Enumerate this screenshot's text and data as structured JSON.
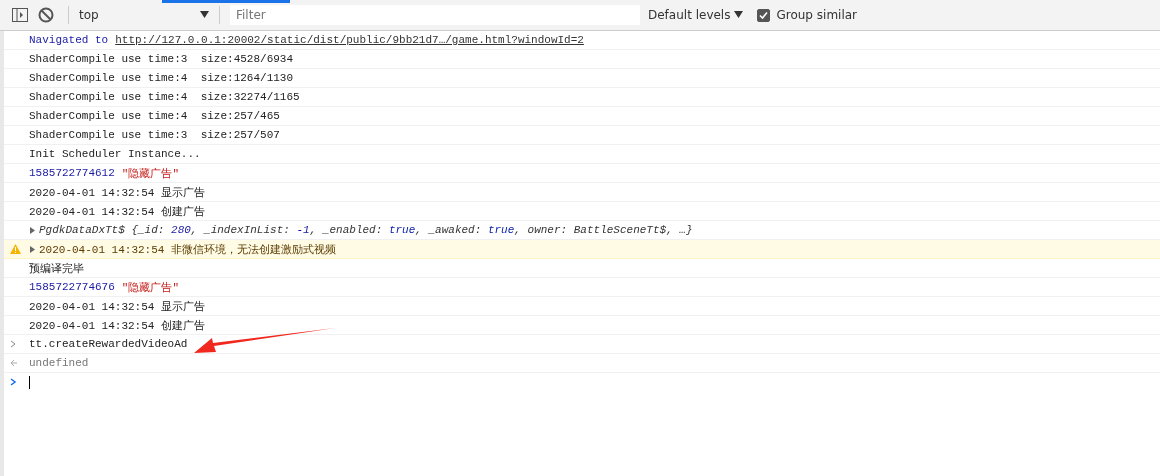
{
  "toolbar": {
    "context": "top",
    "filter": {
      "placeholder": "Filter"
    },
    "levels": "Default levels",
    "group_similar": {
      "label": "Group similar",
      "checked": true
    }
  },
  "console": [
    {
      "kind": "nav",
      "prefix": "Navigated to",
      "link": "http://127.0.0.1:20002/static/dist/public/9bb21d7…/game.html?windowId=2"
    },
    {
      "kind": "log",
      "text": "ShaderCompile use time:3  size:4528/6934"
    },
    {
      "kind": "log",
      "text": "ShaderCompile use time:4  size:1264/1130"
    },
    {
      "kind": "log",
      "text": "ShaderCompile use time:4  size:32274/1165"
    },
    {
      "kind": "log",
      "text": "ShaderCompile use time:4  size:257/465"
    },
    {
      "kind": "log",
      "text": "ShaderCompile use time:3  size:257/507"
    },
    {
      "kind": "log",
      "text": "Init Scheduler Instance..."
    },
    {
      "kind": "numstr",
      "number": "1585722774612",
      "string": "\"隐藏广告\""
    },
    {
      "kind": "log",
      "text": "2020-04-01 14:32:54 显示广告"
    },
    {
      "kind": "log",
      "text": "2020-04-01 14:32:54 创建广告"
    },
    {
      "kind": "object",
      "expanded": false,
      "parts": [
        {
          "text": "PgdkDataDxTt$ {_id: ",
          "kind": "plain"
        },
        {
          "text": "280",
          "kind": "number"
        },
        {
          "text": ", _indexInList: ",
          "kind": "plain"
        },
        {
          "text": "-1",
          "kind": "number"
        },
        {
          "text": ", _enabled: ",
          "kind": "plain"
        },
        {
          "text": "true",
          "kind": "bool"
        },
        {
          "text": ", _awaked: ",
          "kind": "plain"
        },
        {
          "text": "true",
          "kind": "bool"
        },
        {
          "text": ", owner: BattleSceneTt$, …}",
          "kind": "plain"
        }
      ]
    },
    {
      "kind": "warning",
      "expanded": false,
      "text": "2020-04-01 14:32:54 非微信环境，无法创建激励式视频"
    },
    {
      "kind": "log",
      "text": "预编译完毕"
    },
    {
      "kind": "numstr",
      "number": "1585722774676",
      "string": "\"隐藏广告\""
    },
    {
      "kind": "log",
      "text": "2020-04-01 14:32:54 显示广告"
    },
    {
      "kind": "log",
      "text": "2020-04-01 14:32:54 创建广告"
    },
    {
      "kind": "input",
      "text": "tt.createRewardedVideoAd"
    },
    {
      "kind": "result",
      "text": "undefined"
    },
    {
      "kind": "prompt"
    }
  ]
}
